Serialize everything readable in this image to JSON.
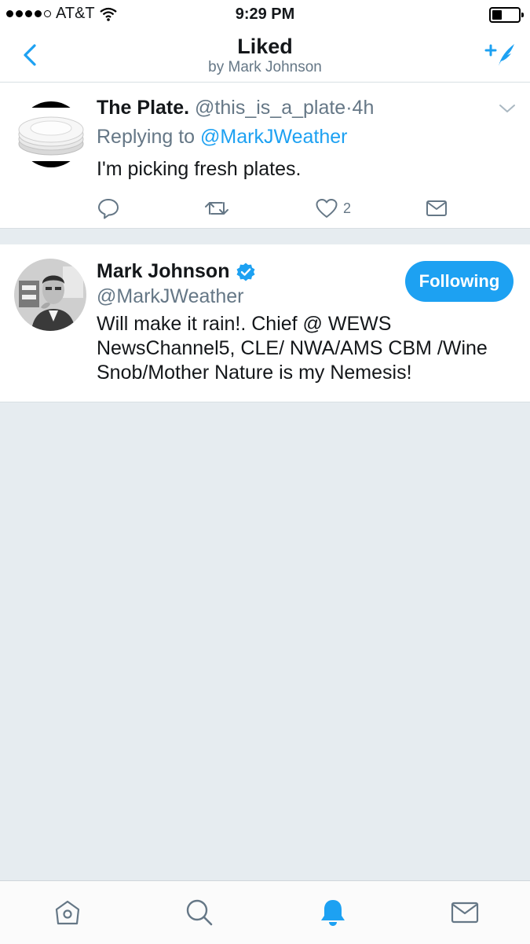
{
  "status_bar": {
    "carrier": "AT&T",
    "time": "9:29 PM",
    "signal_bars_filled": 4,
    "signal_bars_total": 5,
    "battery_level": 0.35
  },
  "nav": {
    "title": "Liked",
    "subtitle": "by Mark Johnson",
    "back_icon": "chevron-left-icon",
    "compose_icon": "compose-tweet-icon"
  },
  "tweet": {
    "name": "The Plate.",
    "handle": "@this_is_a_plate",
    "separator": "·",
    "time": "4h",
    "reply_prefix": "Replying to",
    "reply_to": "@MarkJWeather",
    "text": "I'm picking fresh plates.",
    "like_count": "2",
    "actions": [
      "reply-icon",
      "retweet-icon",
      "heart-icon",
      "direct-message-icon"
    ]
  },
  "profile": {
    "name": "Mark Johnson",
    "verified": true,
    "handle": "@MarkJWeather",
    "bio": "Will make it rain!. Chief @ WEWS NewsChannel5, CLE/ NWA/AMS CBM /Wine Snob/Mother Nature is my Nemesis!",
    "follow_label": "Following"
  },
  "tab_bar": {
    "items": [
      "home-icon",
      "search-icon",
      "notifications-icon",
      "messages-icon"
    ],
    "active": "notifications-icon"
  },
  "colors": {
    "accent": "#1da1f2",
    "secondary_text": "#657786",
    "background": "#e6ecf0"
  }
}
